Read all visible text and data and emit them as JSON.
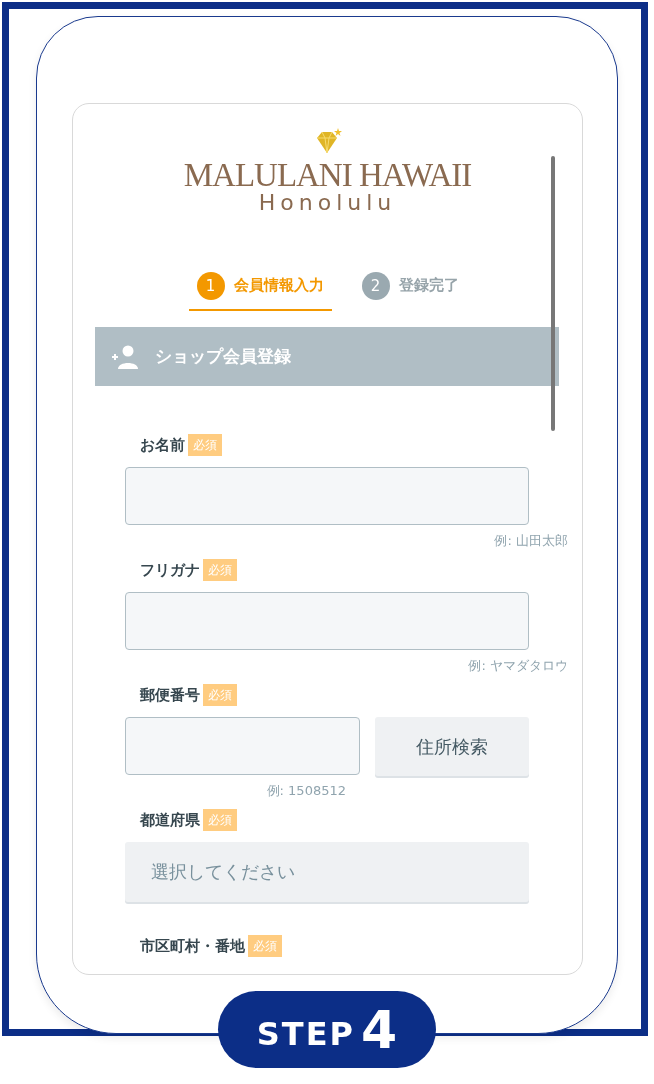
{
  "logo": {
    "title": "MALULANI HAWAII",
    "subtitle": "Honolulu"
  },
  "steps": [
    {
      "number": "1",
      "label": "会員情報入力",
      "selected": true
    },
    {
      "number": "2",
      "label": "登録完了",
      "selected": false
    }
  ],
  "section": {
    "title": "ショップ会員登録"
  },
  "fields": [
    {
      "kind": "text",
      "label": "お名前",
      "badge": "必須",
      "hint": "例: 山田太郎"
    },
    {
      "kind": "text",
      "label": "フリガナ",
      "badge": "必須",
      "hint": "例: ヤマダタロウ"
    },
    {
      "kind": "postal",
      "label": "郵便番号",
      "badge": "必須",
      "hint": "例: 1508512",
      "button": "住所検索"
    },
    {
      "kind": "select",
      "label": "都道府県",
      "badge": "必須",
      "placeholder": "選択してください"
    },
    {
      "kind": "heading",
      "label": "市区町村・番地",
      "badge": "必須"
    }
  ],
  "step_badge": {
    "word": "STEP",
    "number": "4"
  }
}
